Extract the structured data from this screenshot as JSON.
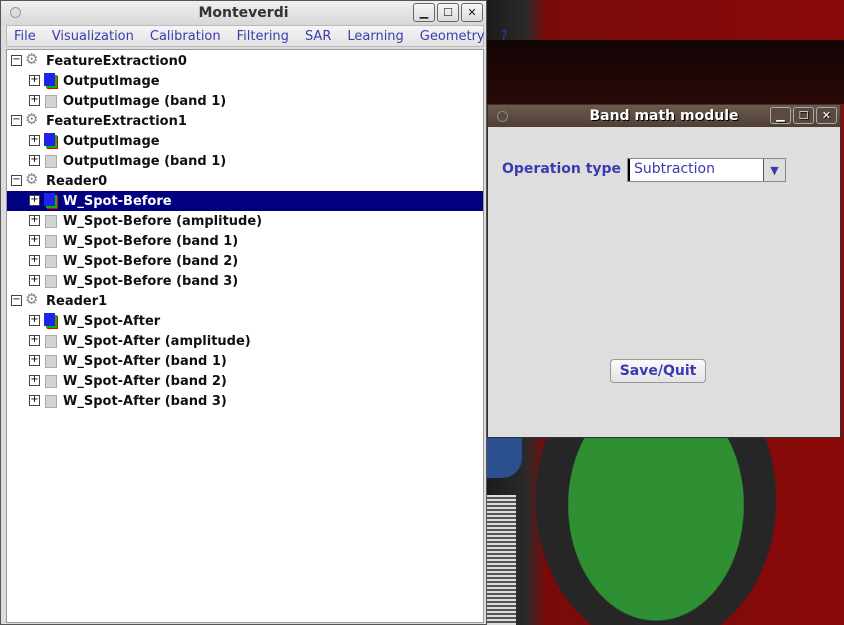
{
  "main_window": {
    "title": "Monteverdi"
  },
  "menu": [
    "File",
    "Visualization",
    "Calibration",
    "Filtering",
    "SAR",
    "Learning",
    "Geometry",
    "?"
  ],
  "tree": [
    {
      "level": 0,
      "label": "FeatureExtraction0",
      "icon": "gears-icon",
      "expander": "-"
    },
    {
      "level": 1,
      "label": "OutputImage",
      "icon": "rgb-image-icon",
      "expander": "+"
    },
    {
      "level": 1,
      "label": "OutputImage (band 1)",
      "icon": "gray-image-icon",
      "expander": "+"
    },
    {
      "level": 0,
      "label": "FeatureExtraction1",
      "icon": "gears-icon",
      "expander": "-"
    },
    {
      "level": 1,
      "label": "OutputImage",
      "icon": "rgb-image-icon",
      "expander": "+"
    },
    {
      "level": 1,
      "label": "OutputImage (band 1)",
      "icon": "gray-image-icon",
      "expander": "+"
    },
    {
      "level": 0,
      "label": "Reader0",
      "icon": "gears-icon",
      "expander": "-"
    },
    {
      "level": 1,
      "label": "W_Spot-Before",
      "icon": "rgb-image-icon",
      "expander": "+",
      "selected": true
    },
    {
      "level": 1,
      "label": "W_Spot-Before (amplitude)",
      "icon": "gray-image-icon",
      "expander": "+"
    },
    {
      "level": 1,
      "label": "W_Spot-Before (band 1)",
      "icon": "gray-image-icon",
      "expander": "+"
    },
    {
      "level": 1,
      "label": "W_Spot-Before (band 2)",
      "icon": "gray-image-icon",
      "expander": "+"
    },
    {
      "level": 1,
      "label": "W_Spot-Before (band 3)",
      "icon": "gray-image-icon",
      "expander": "+"
    },
    {
      "level": 0,
      "label": "Reader1",
      "icon": "gears-icon",
      "expander": "-"
    },
    {
      "level": 1,
      "label": "W_Spot-After",
      "icon": "rgb-image-icon",
      "expander": "+"
    },
    {
      "level": 1,
      "label": "W_Spot-After (amplitude)",
      "icon": "gray-image-icon",
      "expander": "+"
    },
    {
      "level": 1,
      "label": "W_Spot-After (band 1)",
      "icon": "gray-image-icon",
      "expander": "+"
    },
    {
      "level": 1,
      "label": "W_Spot-After (band 2)",
      "icon": "gray-image-icon",
      "expander": "+"
    },
    {
      "level": 1,
      "label": "W_Spot-After (band 3)",
      "icon": "gray-image-icon",
      "expander": "+"
    }
  ],
  "band_math": {
    "title": "Band math module",
    "operation_label": "Operation type",
    "operation_value": "Subtraction",
    "save_quit": "Save/Quit"
  },
  "colors": {
    "menu_text": "#3b3bb0",
    "selection": "#000080",
    "band_title_bar": "#5a4a40"
  }
}
